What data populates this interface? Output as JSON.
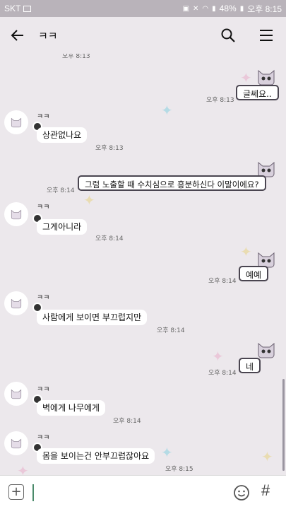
{
  "status": {
    "carrier": "SKT",
    "battery": "48%",
    "time": "오후 8:15"
  },
  "header": {
    "title": "ㅋㅋ"
  },
  "messages": [
    {
      "time": "오후 8:13"
    },
    {
      "text": "글쎄요..",
      "time": "오후 8:13"
    },
    {
      "name": "ㅋㅋ",
      "text": "상관없나요",
      "time": "오후 8:13"
    },
    {
      "text": "그럼 노출할 때 수치심으로 흥분하신다 이말이에요?",
      "time": "오후 8:14"
    },
    {
      "name": "ㅋㅋ",
      "text": "그게아니라",
      "time": "오후 8:14"
    },
    {
      "text": "예예",
      "time": "오후 8:14"
    },
    {
      "name": "ㅋㅋ",
      "text": "사람에게 보이면 부끄럽지만",
      "time": "오후 8:14"
    },
    {
      "text": "네",
      "time": "오후 8:14"
    },
    {
      "name": "ㅋㅋ",
      "text": "벽에게 나무에게",
      "time": "오후 8:14"
    },
    {
      "name": "ㅋㅋ",
      "text": "몸을 보이는건 안부끄럽잖아요",
      "time": "오후 8:15"
    }
  ],
  "input": {
    "placeholder": "",
    "hash": "#"
  },
  "colors": {
    "background": "#ece8ec",
    "statusbar": "#b9b3ba",
    "bubble_border": "#4a4550"
  }
}
